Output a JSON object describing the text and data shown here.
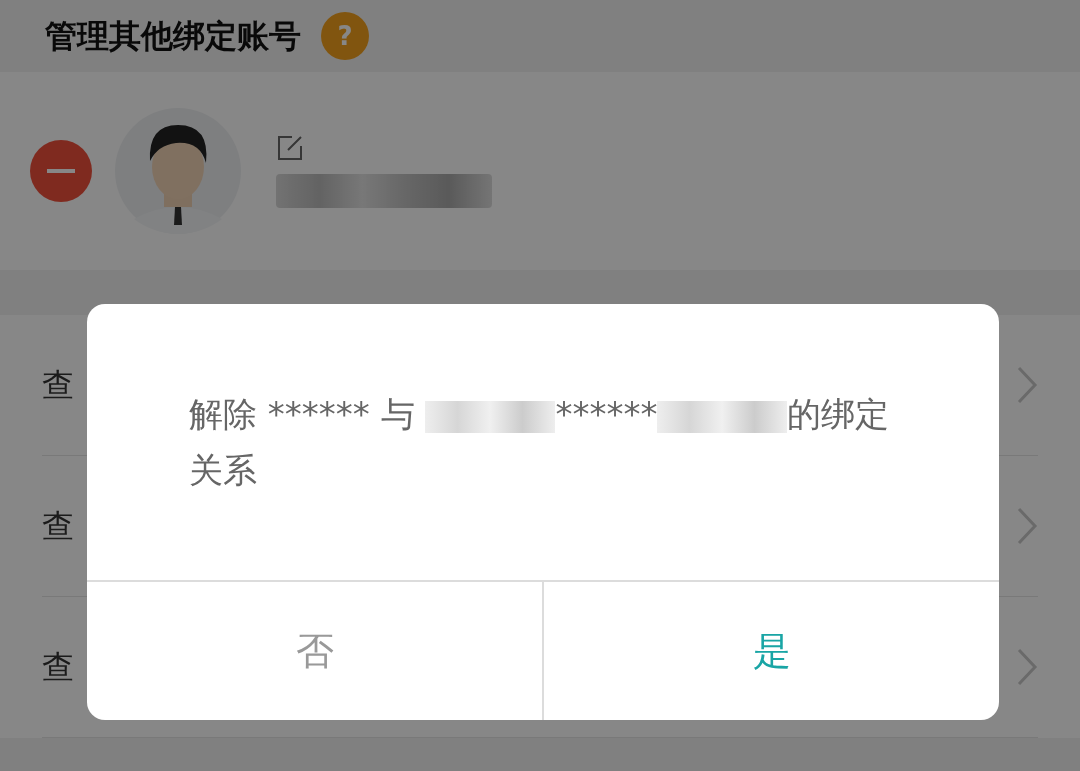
{
  "header": {
    "title": "管理其他绑定账号",
    "help_icon": "?"
  },
  "account": {
    "removable": true,
    "name_redacted": true
  },
  "rows": [
    {
      "label": "查"
    },
    {
      "label": "查"
    },
    {
      "label": "查"
    }
  ],
  "dialog": {
    "message": [
      {
        "kind": "text",
        "text": "解除 ****** 与 "
      },
      {
        "kind": "redacted"
      },
      {
        "kind": "text",
        "text": "******"
      },
      {
        "kind": "redacted"
      },
      {
        "kind": "text",
        "text": "的绑定关系"
      }
    ],
    "buttons": [
      {
        "label": "否",
        "primary": false
      },
      {
        "label": "是",
        "primary": true
      }
    ]
  }
}
